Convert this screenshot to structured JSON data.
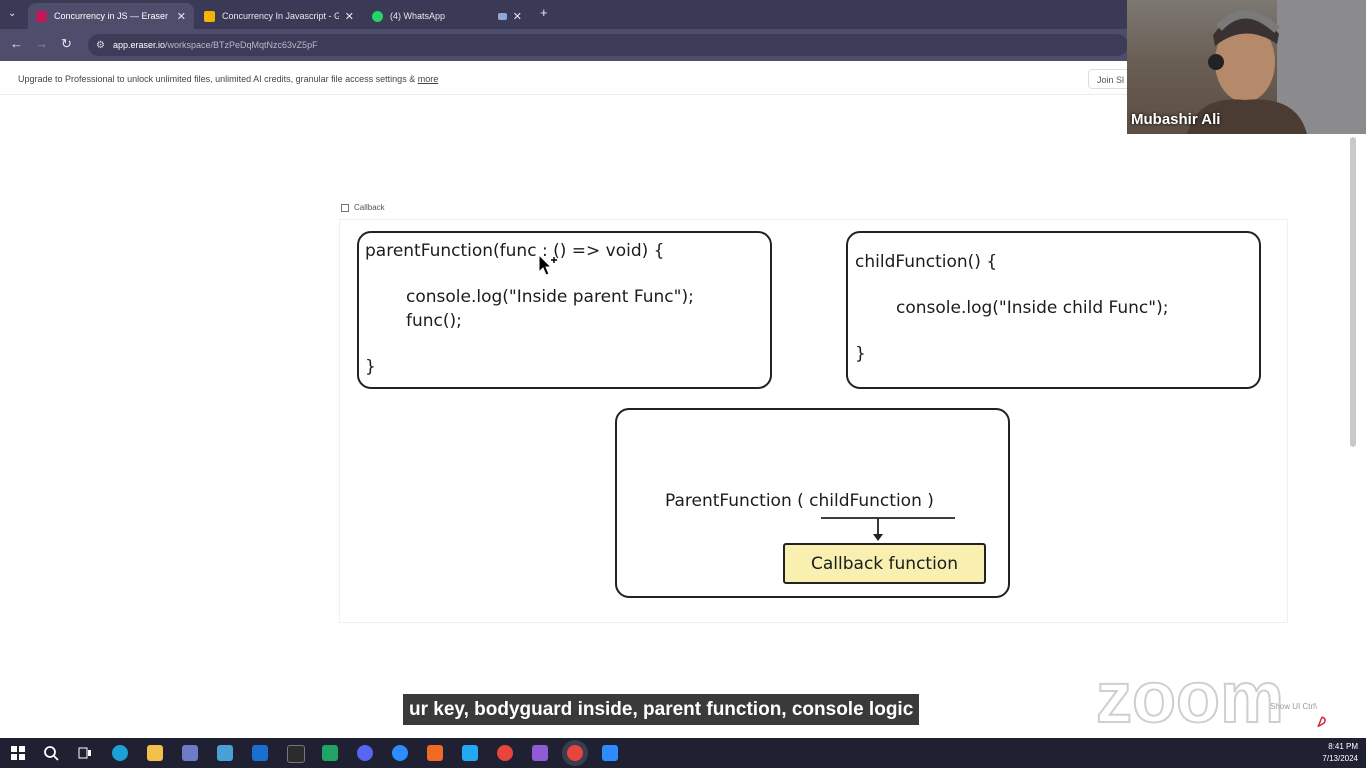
{
  "browser": {
    "tabs": [
      {
        "title": "Concurrency in JS — Eraser",
        "favicon_color": "#c2185b",
        "active": true
      },
      {
        "title": "Concurrency In Javascript - Go",
        "favicon_color": "#f4b400",
        "active": false
      },
      {
        "title": "(4) WhatsApp",
        "favicon_color": "#25d366",
        "active": false
      }
    ],
    "new_tab_label": "+",
    "url_host": "app.eraser.io",
    "url_path": "/workspace/BTzPeDqMqtNzc63vZ5pF"
  },
  "banner": {
    "message": "Upgrade to Professional to unlock unlimited files, unlimited AI credits, granular file access settings & ",
    "more_link": "more",
    "join_label": "Join Sl"
  },
  "canvas": {
    "frame_label": "Callback",
    "parent_box": {
      "line1": "parentFunction(func : () => void) {",
      "line2": "console.log(\"Inside parent Func\");",
      "line3": "func();",
      "line4": "}"
    },
    "child_box": {
      "line1": "childFunction() {",
      "line2": "console.log(\"Inside child Func\");",
      "line3": "}"
    },
    "call_box": {
      "call_prefix": "ParentFunction ( ",
      "call_arg": "childFunction",
      "call_suffix": " )",
      "label": "Callback function"
    }
  },
  "video": {
    "participant_name": "Mubashir Ali"
  },
  "caption": {
    "text": "ur key, bodyguard inside, parent function, console logic"
  },
  "zoom": {
    "watermark": "zoom",
    "show_ui": "Show UI  Ctrl\\"
  },
  "taskbar": {
    "icons": [
      "windows-start",
      "search",
      "task-view",
      "edge",
      "file-explorer",
      "app-blue",
      "notepad",
      "mail",
      "terminal",
      "sheets",
      "discord",
      "zoom-app",
      "brave",
      "vscode",
      "chrome",
      "github-desktop",
      "chrome-active",
      "zoom-meeting"
    ],
    "time": "8:41 PM",
    "date": "7/13/2024"
  },
  "colors": {
    "callback_fill": "#f8efb0",
    "tabstrip": "#3b3a56",
    "navbar": "#4e4d6c",
    "taskbar": "#1f2133"
  }
}
